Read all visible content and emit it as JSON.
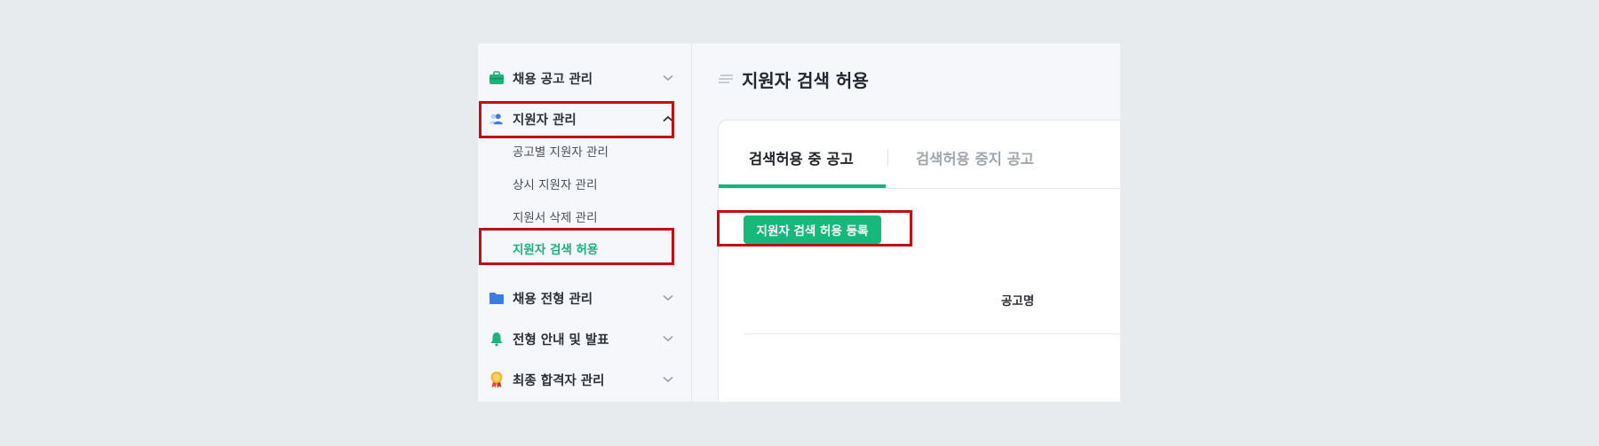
{
  "sidebar": {
    "menus": [
      {
        "label": "채용 공고 관리",
        "icon": "briefcase-icon",
        "expanded": false
      },
      {
        "label": "지원자 관리",
        "icon": "users-icon",
        "expanded": true
      },
      {
        "label": "채용 전형 관리",
        "icon": "folder-icon",
        "expanded": false
      },
      {
        "label": "전형 안내 및 발표",
        "icon": "bell-icon",
        "expanded": false
      },
      {
        "label": "최종 합격자 관리",
        "icon": "award-medal-icon",
        "expanded": false
      }
    ],
    "submenu": [
      {
        "label": "공고별 지원자 관리"
      },
      {
        "label": "상시 지원자 관리"
      },
      {
        "label": "지원서 삭제 관리"
      },
      {
        "label": "지원자 검색 허용",
        "active": true
      }
    ]
  },
  "main": {
    "title": "지원자 검색 허용",
    "tabs": [
      {
        "label": "검색허용 중 공고",
        "active": true
      },
      {
        "label": "검색허용 중지 공고",
        "active": false
      }
    ],
    "register_button": "지원자 검색 허용 등록",
    "table": {
      "columns": [
        "공고명"
      ]
    }
  },
  "colors": {
    "accent": "#16b37a",
    "highlight_box": "#c40d12",
    "background": "#e8ebee"
  }
}
